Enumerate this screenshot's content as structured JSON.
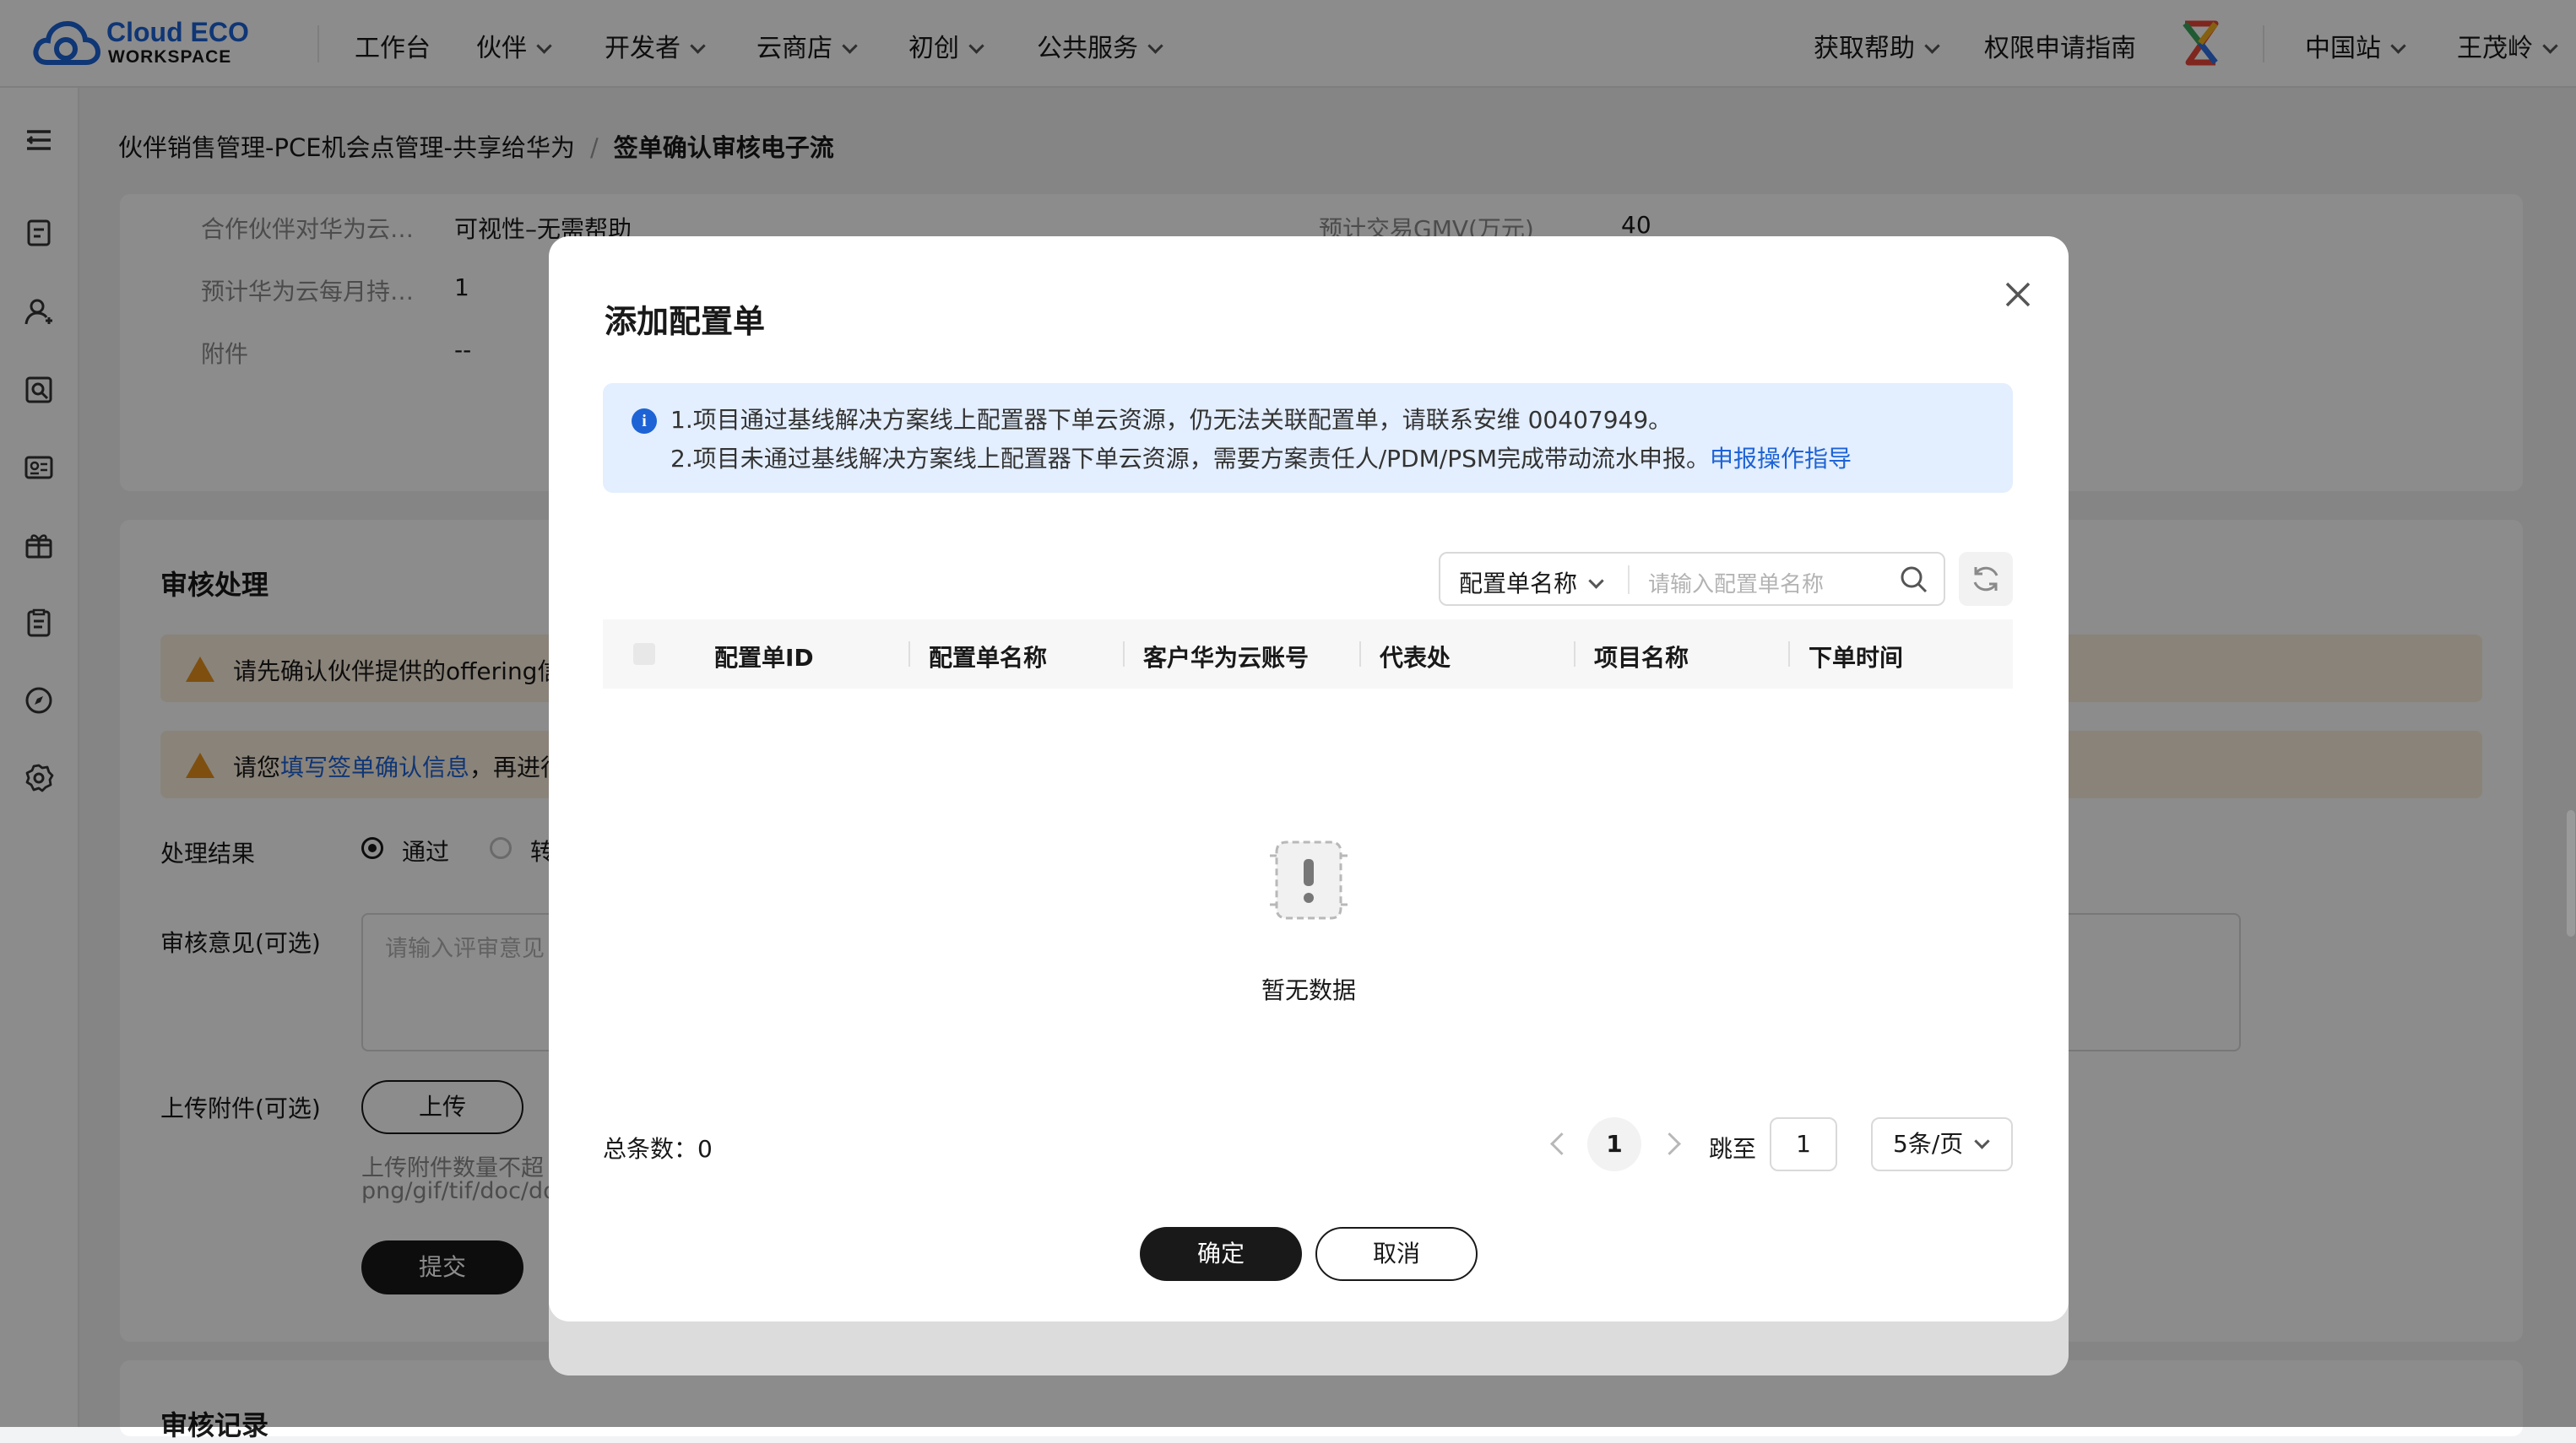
{
  "header": {
    "logo_line1": "Cloud ECO",
    "logo_line2": "WORKSPACE",
    "nav": [
      {
        "label": "工作台",
        "has_menu": false
      },
      {
        "label": "伙伴",
        "has_menu": true
      },
      {
        "label": "开发者",
        "has_menu": true
      },
      {
        "label": "云商店",
        "has_menu": true
      },
      {
        "label": "初创",
        "has_menu": true
      },
      {
        "label": "公共服务",
        "has_menu": true
      }
    ],
    "right": {
      "help": "获取帮助",
      "permission_guide": "权限申请指南",
      "site": "中国站",
      "user": "王茂岭"
    }
  },
  "sidebar": {
    "icons": [
      "menu-icon",
      "document-icon",
      "user-icon",
      "search-doc-icon",
      "id-card-icon",
      "gift-icon",
      "clipboard-icon",
      "compass-icon",
      "gear-icon"
    ]
  },
  "breadcrumb": {
    "parent": "伙伴销售管理-PCE机会点管理-共享给华为",
    "separator": "/",
    "current": "签单确认审核电子流"
  },
  "background": {
    "info_rows": [
      {
        "label": "合作伙伴对华为云…",
        "value": "可视性–无需帮助"
      },
      {
        "label": "预计华为云每月持…",
        "value": "1"
      },
      {
        "label": "附件",
        "value": "--"
      }
    ],
    "gmv_label": "预计交易GMV(万元)",
    "gmv_value": "40",
    "review_title": "审核处理",
    "warn1": "请先确认伙伴提供的offering信",
    "warn2_prefix": "请您",
    "warn2_link": "填写签单确认信息",
    "warn2_suffix": "，再进行",
    "result_label": "处理结果",
    "result_pass": "通过",
    "result_transfer": "转",
    "opinion_label": "审核意见(可选)",
    "opinion_placeholder": "请输入评审意见",
    "upload_label": "上传附件(可选)",
    "upload_btn": "上传",
    "upload_hint1": "上传附件数量不超",
    "upload_hint2": "png/gif/tif/doc/doc",
    "submit_btn": "提交",
    "record_title": "审核记录"
  },
  "modal": {
    "title": "添加配置单",
    "info_line1": "1.项目通过基线解决方案线上配置器下单云资源，仍无法关联配置单，请联系安维 00407949。",
    "info_line2": "2.项目未通过基线解决方案线上配置器下单云资源，需要方案责任人/PDM/PSM完成带动流水申报。",
    "info_link": "申报操作指导",
    "search_field": "配置单名称",
    "search_placeholder": "请输入配置单名称",
    "columns": [
      "配置单ID",
      "配置单名称",
      "客户华为云账号",
      "代表处",
      "项目名称",
      "下单时间"
    ],
    "empty_text": "暂无数据",
    "total_label": "总条数：",
    "total_value": "0",
    "current_page": "1",
    "jump_label": "跳至",
    "jump_value": "1",
    "page_size": "5条/页",
    "ok": "确定",
    "cancel": "取消"
  },
  "colors": {
    "accent": "#1d63d6",
    "warning": "#e6911a",
    "primary_button": "#191919",
    "info_bg": "#e3eefe"
  }
}
